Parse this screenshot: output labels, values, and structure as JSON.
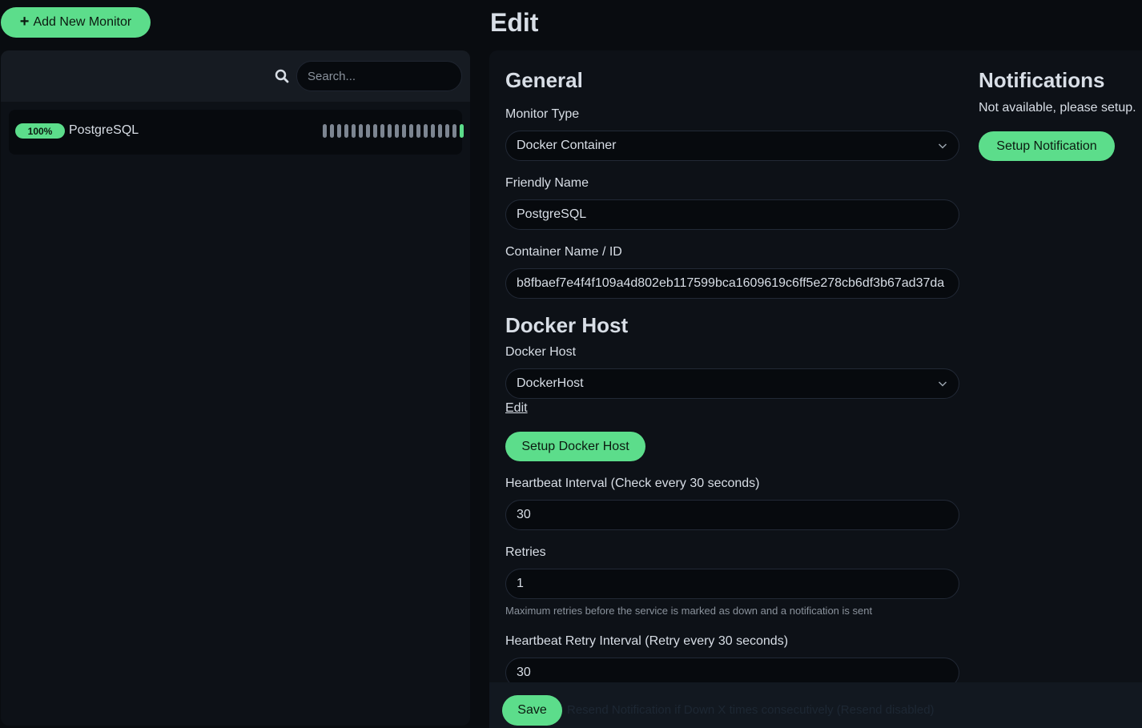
{
  "sidebar": {
    "add_button_label": "Add New Monitor",
    "search": {
      "placeholder": "Search..."
    },
    "monitors": [
      {
        "uptime": "100%",
        "name": "PostgreSQL",
        "beats": [
          "pending",
          "pending",
          "pending",
          "pending",
          "pending",
          "pending",
          "pending",
          "pending",
          "pending",
          "pending",
          "pending",
          "pending",
          "pending",
          "pending",
          "pending",
          "pending",
          "pending",
          "pending",
          "pending",
          "up"
        ]
      }
    ]
  },
  "page": {
    "title": "Edit"
  },
  "general": {
    "title": "General",
    "monitor_type": {
      "label": "Monitor Type",
      "value": "Docker Container"
    },
    "friendly_name": {
      "label": "Friendly Name",
      "value": "PostgreSQL"
    },
    "container": {
      "label": "Container Name / ID",
      "value": "b8fbaef7e4f4f109a4d802eb117599bca1609619c6ff5e278cb6df3b67ad37da"
    }
  },
  "docker_host": {
    "title": "Docker Host",
    "label": "Docker Host",
    "value": "DockerHost",
    "edit_link": "Edit",
    "setup_button": "Setup Docker Host"
  },
  "heartbeat": {
    "interval_label": "Heartbeat Interval (Check every 30 seconds)",
    "interval_value": "30",
    "retries_label": "Retries",
    "retries_value": "1",
    "retries_help": "Maximum retries before the service is marked as down and a notification is sent",
    "retry_interval_label": "Heartbeat Retry Interval (Retry every 30 seconds)",
    "retry_interval_value": "30"
  },
  "notifications": {
    "title": "Notifications",
    "empty_text": "Not available, please setup.",
    "setup_button": "Setup Notification"
  },
  "footer": {
    "save_label": "Save",
    "faded_text": "Resend Notification if Down X times consecutively (Resend disabled)"
  },
  "colors": {
    "accent": "#5cdd8b",
    "background": "#090c10",
    "panel": "#0d1117",
    "beat_pending": "#7c8591"
  }
}
